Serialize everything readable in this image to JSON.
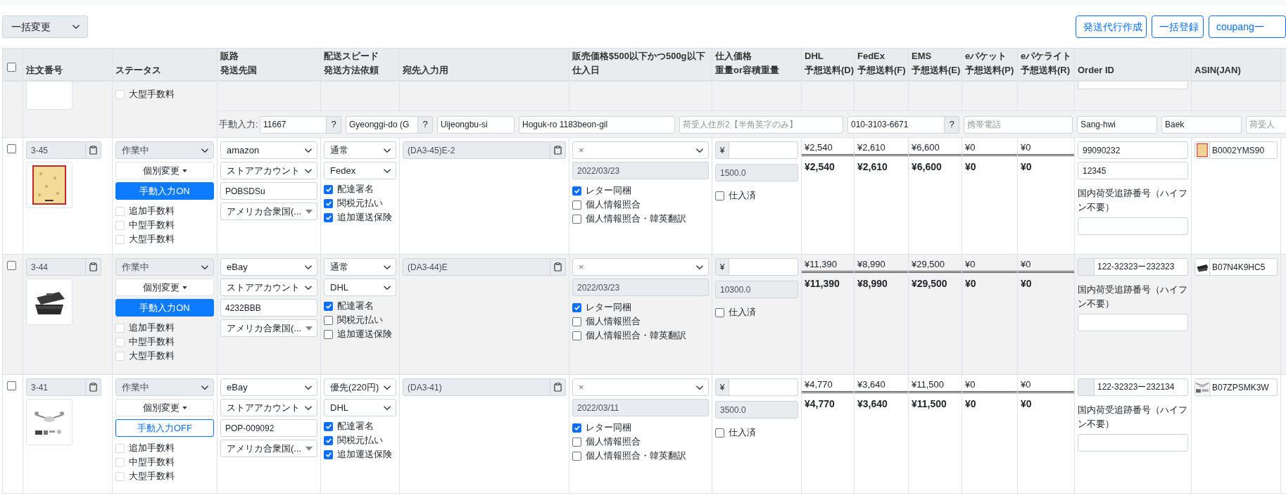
{
  "toolbar": {
    "bulk_select": "一括変更",
    "buttons": [
      "発送代行作成",
      "一括登録",
      "coupang一"
    ]
  },
  "table": {
    "select_all": {
      "checked": false
    },
    "columns": [
      {
        "lines": [
          "注文番号"
        ]
      },
      {
        "lines": [
          "ステータス"
        ]
      },
      {
        "lines": [
          "販路",
          "発送先国"
        ]
      },
      {
        "lines": [
          "配送スピード",
          "発送方法依頼"
        ]
      },
      {
        "lines": [
          "宛先入力用"
        ]
      },
      {
        "lines": [
          "販売価格$500以下かつ500g以下",
          "仕入日"
        ]
      },
      {
        "lines": [
          "仕入価格",
          "重量or容積重量"
        ]
      },
      {
        "lines": [
          "DHL",
          "予想送料(D)"
        ]
      },
      {
        "lines": [
          "FedEx",
          "予想送料(F)"
        ]
      },
      {
        "lines": [
          "EMS",
          "予想送料(E)"
        ]
      },
      {
        "lines": [
          "eパケット",
          "予想送料(P)"
        ]
      },
      {
        "lines": [
          "eパケライト",
          "予想送料(R)"
        ]
      },
      {
        "lines": [
          "Order ID"
        ]
      },
      {
        "lines": [
          "ASIN(JAN)"
        ]
      }
    ],
    "partial_row": {
      "fee": {
        "label": "大型手数料",
        "checked": false,
        "disabled": true
      },
      "manual_label": "手動入力:",
      "fields": [
        {
          "value": "11667",
          "addon": "?"
        },
        {
          "value": "Gyeonggi-do (G",
          "addon": "?"
        },
        {
          "value": "Uijeongbu-si"
        },
        {
          "value": "Hoguk-ro 1183beon-gil"
        },
        {
          "placeholder": "荷受人住所2【半角英字のみ】"
        },
        {
          "value": "010-3103-6671",
          "addon": "?"
        },
        {
          "placeholder": "携帯電話"
        },
        {
          "value": "Sang-hwi"
        },
        {
          "value": "Baek"
        },
        {
          "placeholder": "荷受人"
        }
      ]
    },
    "rows": [
      {
        "checked": false,
        "order_no": "3-45",
        "status": "作業中",
        "individual_change": "個別変更",
        "manual": {
          "label": "手動入力ON",
          "on": true
        },
        "fees": [
          {
            "label": "追加手数料",
            "checked": false,
            "disabled": true
          },
          {
            "label": "中型手数料",
            "checked": false,
            "disabled": true
          },
          {
            "label": "大型手数料",
            "checked": false,
            "disabled": true
          }
        ],
        "channel": "amazon",
        "account": "ストアアカウント",
        "account_id": "POBSDSu",
        "country": "アメリカ合衆国(...",
        "speed": "通常",
        "method": "Fedex",
        "shipping_options": [
          {
            "label": "配達署名",
            "checked": true
          },
          {
            "label": "関税元払い",
            "checked": true
          },
          {
            "label": "追加運送保険",
            "checked": true
          }
        ],
        "destination": "(DA3-45)E-2",
        "price_flag": "×",
        "purchase_date": "2022/03/23",
        "extras": [
          {
            "label": "レター同梱",
            "checked": true
          },
          {
            "label": "個人情報照合",
            "checked": false
          },
          {
            "label": "個人情報照合・韓英翻訳",
            "checked": false
          }
        ],
        "currency": "¥",
        "weight": "1500.0",
        "purchased": {
          "label": "仕入済",
          "checked": false
        },
        "rates": [
          {
            "estimate": "¥2,540",
            "total": "¥2,540"
          },
          {
            "estimate": "¥2,610",
            "total": "¥2,610"
          },
          {
            "estimate": "¥6,600",
            "total": "¥6,600"
          },
          {
            "estimate": "¥0",
            "total": "¥0"
          },
          {
            "estimate": "¥0",
            "total": "¥0"
          }
        ],
        "order_id": {
          "kind": "plain",
          "fields": [
            "99090232",
            "12345"
          ]
        },
        "tracking_label": "国内荷受追跡番号（ハイフン不要）",
        "asin": "B0002YMS90"
      },
      {
        "checked": false,
        "order_no": "3-44",
        "status": "作業中",
        "individual_change": "個別変更",
        "manual": {
          "label": "手動入力ON",
          "on": true
        },
        "fees": [
          {
            "label": "追加手数料",
            "checked": false,
            "disabled": true
          },
          {
            "label": "中型手数料",
            "checked": false,
            "disabled": true
          },
          {
            "label": "大型手数料",
            "checked": false,
            "disabled": true
          }
        ],
        "channel": "eBay",
        "account": "ストアアカウント",
        "account_id": "4232BBB",
        "country": "アメリカ合衆国(...",
        "speed": "通常",
        "method": "DHL",
        "shipping_options": [
          {
            "label": "配達署名",
            "checked": true
          },
          {
            "label": "関税元払い",
            "checked": false
          },
          {
            "label": "追加運送保険",
            "checked": false
          }
        ],
        "destination": "(DA3-44)E",
        "price_flag": "×",
        "purchase_date": "2022/03/23",
        "extras": [
          {
            "label": "レター同梱",
            "checked": true
          },
          {
            "label": "個人情報照合",
            "checked": false
          },
          {
            "label": "個人情報照合・韓英翻訳",
            "checked": false
          }
        ],
        "currency": "¥",
        "weight": "10300.0",
        "purchased": {
          "label": "仕入済",
          "checked": false
        },
        "rates": [
          {
            "estimate": "¥11,390",
            "total": "¥11,390"
          },
          {
            "estimate": "¥8,990",
            "total": "¥8,990"
          },
          {
            "estimate": "¥29,500",
            "total": "¥29,500"
          },
          {
            "estimate": "¥0",
            "total": "¥0"
          },
          {
            "estimate": "¥0",
            "total": "¥0"
          }
        ],
        "order_id": {
          "kind": "prefixed",
          "fields": [
            "122-32323ー232323"
          ]
        },
        "tracking_label": "国内荷受追跡番号（ハイフン不要）",
        "asin": "B07N4K9HC5"
      },
      {
        "checked": false,
        "order_no": "3-41",
        "status": "作業中",
        "individual_change": "個別変更",
        "manual": {
          "label": "手動入力OFF",
          "on": false
        },
        "fees": [
          {
            "label": "追加手数料",
            "checked": false,
            "disabled": true
          },
          {
            "label": "中型手数料",
            "checked": false,
            "disabled": true
          },
          {
            "label": "大型手数料",
            "checked": false,
            "disabled": true
          }
        ],
        "channel": "eBay",
        "account": "ストアアカウント",
        "account_id": "POP-009092",
        "country": "アメリカ合衆国(...",
        "speed": "優先(220円)",
        "method": "DHL",
        "shipping_options": [
          {
            "label": "配達署名",
            "checked": true
          },
          {
            "label": "関税元払い",
            "checked": true
          },
          {
            "label": "追加運送保険",
            "checked": true
          }
        ],
        "destination": "(DA3-41)",
        "price_flag": "×",
        "purchase_date": "2022/03/11",
        "extras": [
          {
            "label": "レター同梱",
            "checked": true
          },
          {
            "label": "個人情報照合",
            "checked": false
          },
          {
            "label": "個人情報照合・韓英翻訳",
            "checked": false
          }
        ],
        "currency": "¥",
        "weight": "3500.0",
        "purchased": {
          "label": "仕入済",
          "checked": false
        },
        "rates": [
          {
            "estimate": "¥4,770",
            "total": "¥4,770"
          },
          {
            "estimate": "¥3,640",
            "total": "¥3,640"
          },
          {
            "estimate": "¥11,500",
            "total": "¥11,500"
          },
          {
            "estimate": "¥0",
            "total": "¥0"
          },
          {
            "estimate": "¥0",
            "total": "¥0"
          }
        ],
        "order_id": {
          "kind": "prefixed",
          "fields": [
            "122-32323ー232134"
          ]
        },
        "tracking_label": "国内荷受追跡番号（ハイフン不要）",
        "asin": "B07ZPSMK3W"
      }
    ]
  }
}
